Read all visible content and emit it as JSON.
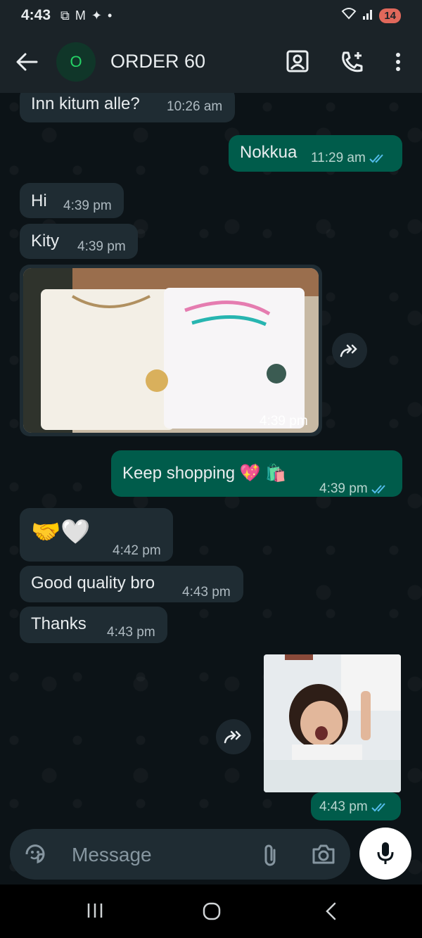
{
  "status_bar": {
    "time": "4:43",
    "battery": "14"
  },
  "header": {
    "avatar_initial": "O",
    "title": "ORDER 60"
  },
  "messages": [
    {
      "dir": "in",
      "text": "Inn kitum alle?",
      "time": "10:26 am"
    },
    {
      "dir": "out",
      "text": "Nokkua",
      "time": "11:29 am",
      "read": true
    },
    {
      "dir": "in",
      "text": "Hi",
      "time": "4:39 pm"
    },
    {
      "dir": "in",
      "text": "Kity",
      "time": "4:39 pm"
    },
    {
      "dir": "in",
      "type": "image",
      "time": "4:39 pm"
    },
    {
      "dir": "out",
      "text": "Keep shopping 💖 🛍️",
      "time": "4:39 pm",
      "read": true
    },
    {
      "dir": "in",
      "text": "🤝🤍",
      "time": "4:42 pm"
    },
    {
      "dir": "in",
      "text": "Good quality bro",
      "time": "4:43 pm"
    },
    {
      "dir": "in",
      "text": "Thanks",
      "time": "4:43 pm"
    },
    {
      "dir": "out",
      "type": "image",
      "time": "4:43 pm",
      "read": true
    }
  ],
  "composer": {
    "placeholder": "Message"
  },
  "colors": {
    "incoming": "#1f2c33",
    "outgoing": "#005c4b",
    "read_tick": "#53bdeb",
    "accent": "#25d366"
  }
}
